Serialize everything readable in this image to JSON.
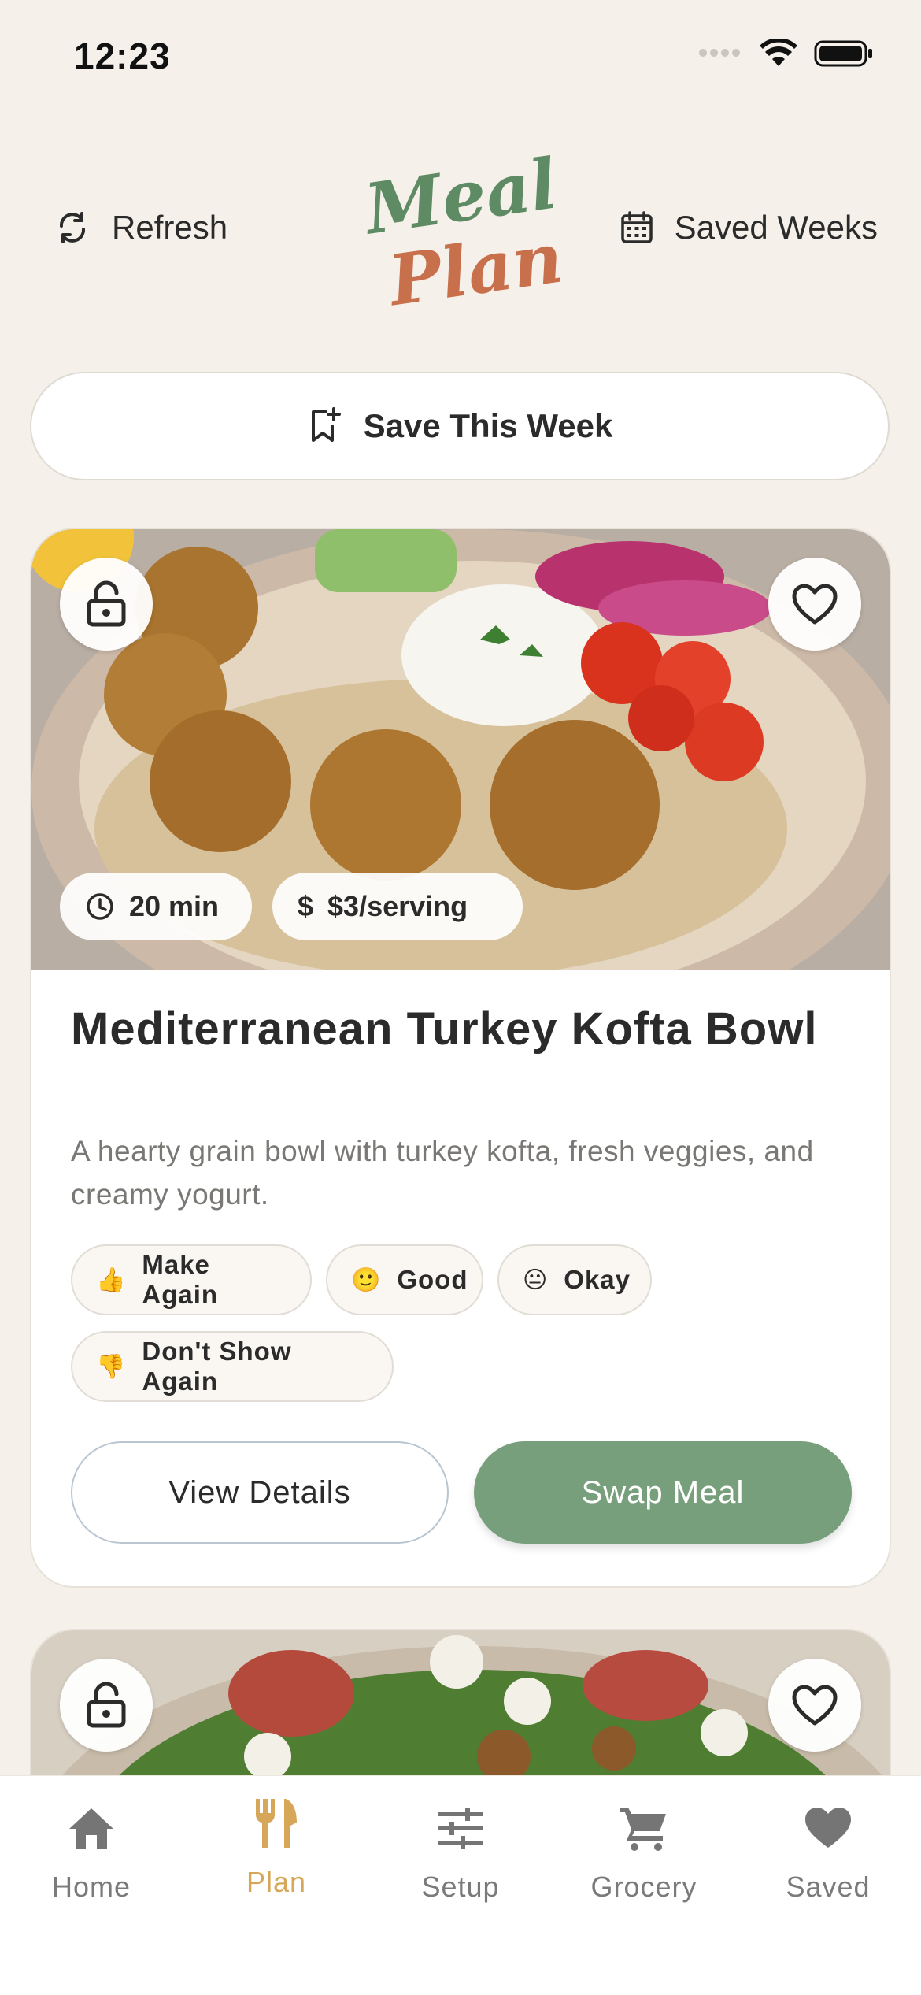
{
  "status_bar": {
    "time": "12:23"
  },
  "header": {
    "refresh_label": "Refresh",
    "logo_line1": "Meal",
    "logo_line2": "Plan",
    "saved_weeks_label": "Saved Weeks"
  },
  "save_week": {
    "label": "Save This Week"
  },
  "meal_card": {
    "time": "20 min",
    "cost": "$3/serving",
    "title": "Mediterranean Turkey Kofta Bowl",
    "description": "A hearty grain bowl with turkey kofta, fresh veggies, and creamy yogurt.",
    "ratings": [
      {
        "emoji": "👍",
        "label": "Make Again"
      },
      {
        "emoji": "🙂",
        "label": "Good"
      },
      {
        "emoji": "😐",
        "label": "Okay"
      },
      {
        "emoji": "👎",
        "label": "Don't Show Again"
      }
    ],
    "view_details_label": "View Details",
    "swap_meal_label": "Swap Meal"
  },
  "tabs": [
    {
      "label": "Home",
      "icon": "home-icon"
    },
    {
      "label": "Plan",
      "icon": "fork-knife-icon",
      "active": true
    },
    {
      "label": "Setup",
      "icon": "sliders-icon"
    },
    {
      "label": "Grocery",
      "icon": "cart-icon"
    },
    {
      "label": "Saved",
      "icon": "heart-icon"
    }
  ],
  "colors": {
    "background": "#f5f1ea",
    "primary_green": "#789f7b",
    "logo_green": "#5f8b64",
    "logo_orange": "#c86f4c",
    "active_tab": "#d6a758"
  }
}
